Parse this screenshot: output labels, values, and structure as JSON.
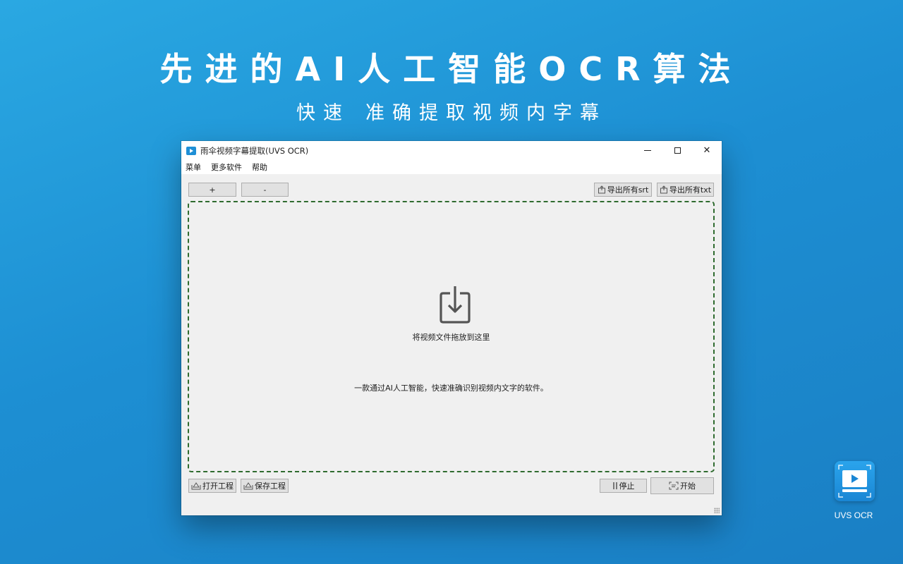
{
  "promo": {
    "headline": "先进的AI人工智能OCR算法",
    "subline_part1": "快速",
    "subline_part2": "准确提取视频内字幕"
  },
  "window": {
    "title": "雨伞视频字幕提取(UVS OCR)",
    "controls": {
      "minimize": "—",
      "maximize": "□",
      "close": "✕"
    },
    "menu": [
      "菜单",
      "更多软件",
      "帮助"
    ],
    "toolbar": {
      "add_label": "+",
      "remove_label": "-",
      "export_srt_label": "导出所有srt",
      "export_txt_label": "导出所有txt"
    },
    "dropzone": {
      "hint": "将视频文件拖放到这里",
      "description": "一款通过AI人工智能，快速准确识别视频内文字的软件。"
    },
    "bottom": {
      "open_project_label": "打开工程",
      "save_project_label": "保存工程",
      "stop_label": "停止",
      "start_label": "开始"
    }
  },
  "brand": {
    "name": "UVS OCR"
  },
  "icons": {
    "app": "video-play-icon",
    "drop": "download-tray-icon",
    "export": "export-icon",
    "project": "project-icon",
    "stop": "stop-icon",
    "start": "scan-icon"
  },
  "colors": {
    "background": "#1d8fd3",
    "dropzone_border": "#2f6b2f",
    "window_bg": "#f0f0f0"
  }
}
